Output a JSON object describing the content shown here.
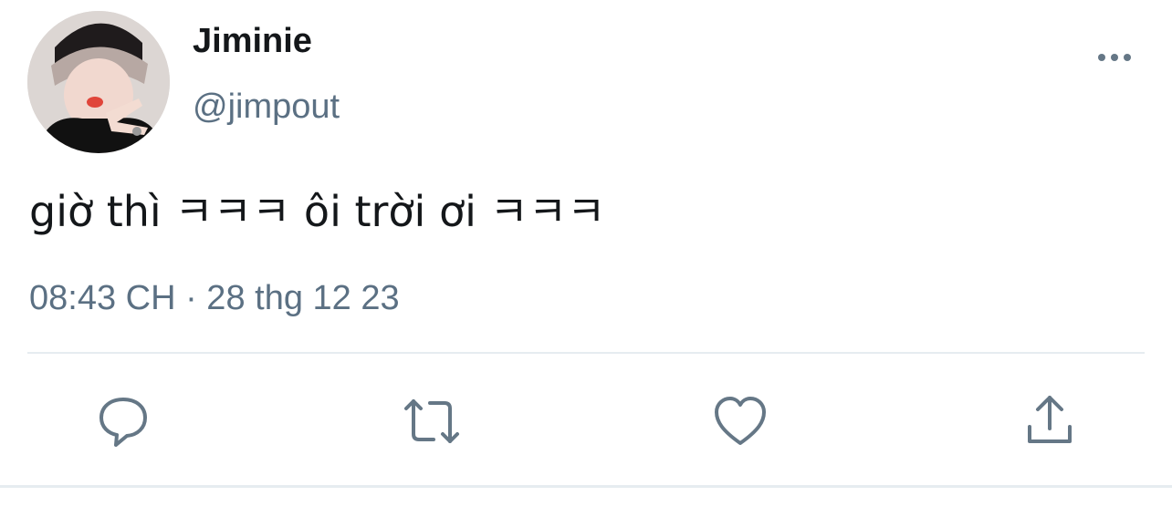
{
  "user": {
    "display_name": "Jiminie",
    "handle": "@jimpout"
  },
  "tweet": {
    "text": "giờ thì ㅋㅋㅋ ôi trời ơi ㅋㅋㅋ",
    "timestamp": "08:43 CH · 28 thg 12 23"
  },
  "actions": [
    {
      "icon": "reply-icon"
    },
    {
      "icon": "retweet-icon"
    },
    {
      "icon": "like-icon"
    },
    {
      "icon": "share-icon"
    }
  ],
  "colors": {
    "text": "#14171a",
    "secondary": "#5b7083",
    "icon": "#657786",
    "divider": "#e6ecf0"
  }
}
